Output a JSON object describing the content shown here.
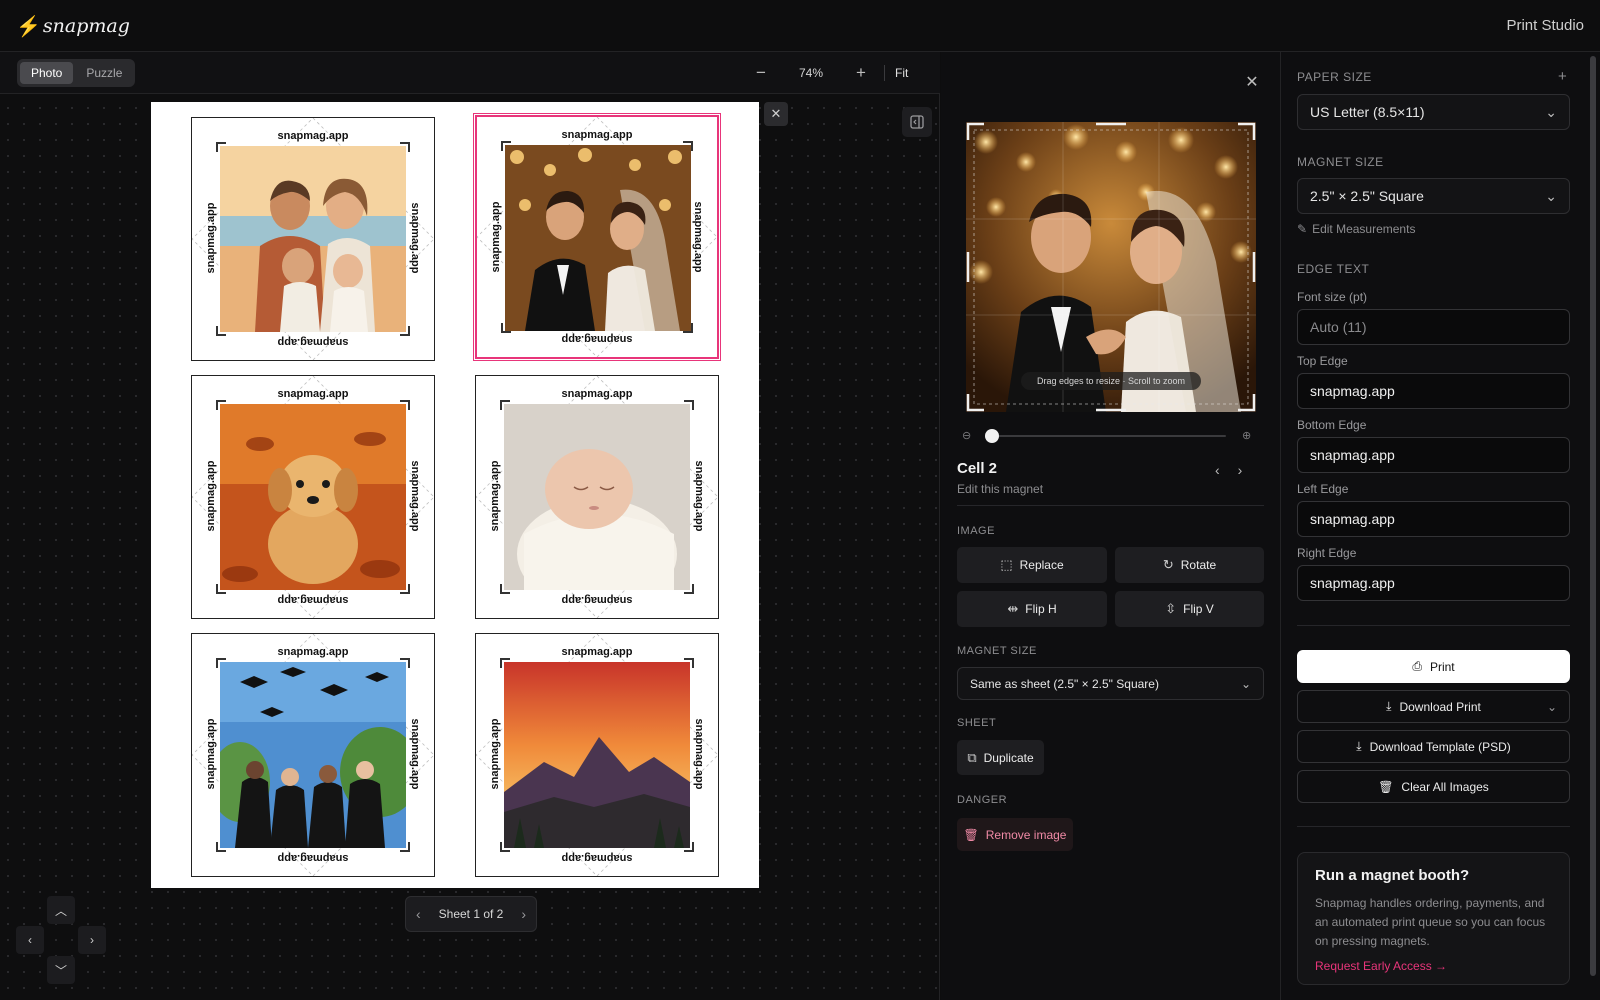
{
  "brand": {
    "logo_text": "snapmag",
    "accent": "#e8357a"
  },
  "header": {
    "app_title": "Print Studio"
  },
  "toolbar": {
    "modes": [
      {
        "label": "Photo",
        "active": true
      },
      {
        "label": "Puzzle",
        "active": false
      }
    ],
    "zoom_out_icon": "minus-icon",
    "zoom_level": "74%",
    "zoom_in_icon": "plus-icon",
    "fit_label": "Fit"
  },
  "sheet": {
    "edge_text": "snapmag.app",
    "cells": [
      {
        "subject": "family on beach"
      },
      {
        "subject": "wedding couple",
        "selected": true
      },
      {
        "subject": "golden retriever puppy"
      },
      {
        "subject": "sleeping newborn"
      },
      {
        "subject": "graduates throwing caps"
      },
      {
        "subject": "mountain sunset"
      }
    ],
    "pagination": {
      "label": "Sheet 1 of 2",
      "current": 1,
      "total": 2
    }
  },
  "editor": {
    "crop_hint": "Drag edges to resize · Scroll to zoom",
    "zoom_slider": 0,
    "title": "Cell 2",
    "subtitle": "Edit this magnet",
    "image_section": "IMAGE",
    "buttons": {
      "replace": "Replace",
      "rotate": "Rotate",
      "flip_h": "Flip H",
      "flip_v": "Flip V"
    },
    "magnet_size_section": "MAGNET SIZE",
    "magnet_size_value": "Same as sheet (2.5\" × 2.5\" Square)",
    "sheet_section": "SHEET",
    "duplicate_label": "Duplicate",
    "danger_section": "DANGER",
    "remove_label": "Remove image"
  },
  "settings": {
    "paper_size_label": "PAPER SIZE",
    "paper_size_value": "US Letter (8.5×11)",
    "magnet_size_label": "MAGNET SIZE",
    "magnet_size_value": "2.5\" × 2.5\" Square",
    "edit_measurements": "Edit Measurements",
    "edge_text_label": "EDGE TEXT",
    "font_size_label": "Font size (pt)",
    "font_size_placeholder": "Auto (11)",
    "top_edge_label": "Top Edge",
    "top_edge_value": "snapmag.app",
    "bottom_edge_label": "Bottom Edge",
    "bottom_edge_value": "snapmag.app",
    "left_edge_label": "Left Edge",
    "left_edge_value": "snapmag.app",
    "right_edge_label": "Right Edge",
    "right_edge_value": "snapmag.app",
    "print_label": "Print",
    "download_print_label": "Download Print",
    "download_template_label": "Download Template (PSD)",
    "clear_all_label": "Clear All Images",
    "promo": {
      "title": "Run a magnet booth?",
      "body": "Snapmag handles ordering, payments, and an automated print queue so you can focus on pressing magnets.",
      "link": "Request Early Access →"
    }
  }
}
